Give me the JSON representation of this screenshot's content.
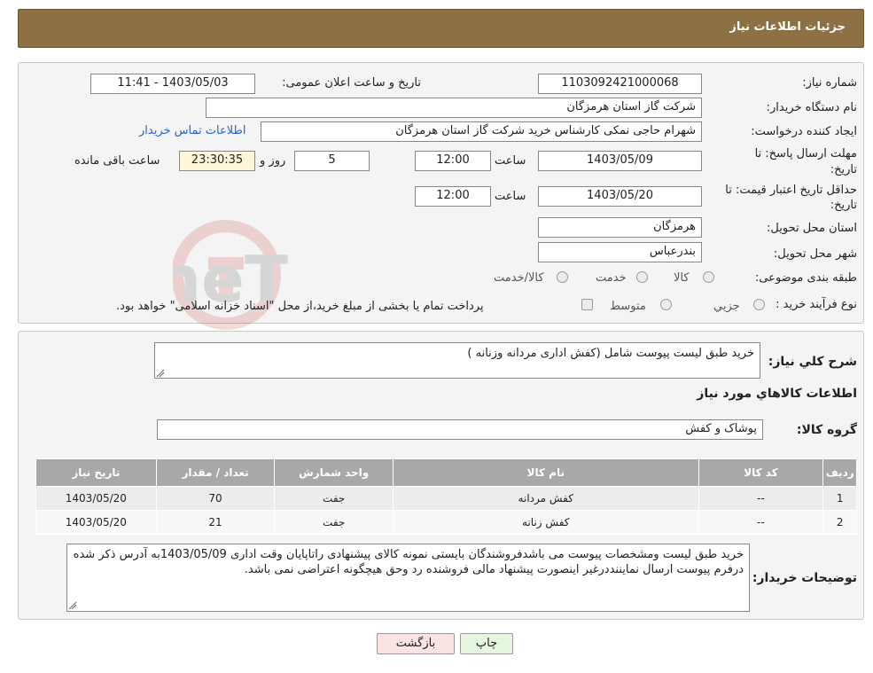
{
  "header": {
    "title": "جزئیات اطلاعات نیاز"
  },
  "details": {
    "need_number_label": "شماره نیاز:",
    "need_number": "1103092421000068",
    "announce_label": "تاریخ و ساعت اعلان عمومی:",
    "announce_value": "1403/05/03 - 11:41",
    "buyer_org_label": "نام دستگاه خریدار:",
    "buyer_org": "شرکت گاز استان هرمزگان",
    "creator_label": "ایجاد کننده درخواست:",
    "creator": "شهرام حاجی نمکی کارشناس خرید شرکت گاز استان هرمزگان",
    "contact_link": "اطلاعات تماس خریدار",
    "deadline_label_1": "مهلت ارسال پاسخ: تا",
    "deadline_label_2": "تاریخ:",
    "deadline_date": "1403/05/09",
    "time_label": "ساعت",
    "deadline_time": "12:00",
    "days_value": "5",
    "days_label": "روز و",
    "remaining_time": "23:30:35",
    "remaining_label": "ساعت باقی مانده",
    "validity_label_1": "حداقل تاریخ اعتبار قیمت: تا",
    "validity_label_2": "تاریخ:",
    "validity_date": "1403/05/20",
    "validity_time": "12:00",
    "province_label": "استان محل تحویل:",
    "province": "هرمزگان",
    "city_label": "شهر محل تحویل:",
    "city": "بندرعباس",
    "category_label": "طبقه بندی موضوعی:",
    "category_options": [
      "کالا",
      "خدمت",
      "کالا/خدمت"
    ],
    "process_label": "نوع فرآیند خرید :",
    "process_options": [
      "جزیي",
      "متوسط"
    ],
    "process_note": "پرداخت تمام یا بخشی از مبلغ خرید،از محل \"اسناد خزانه اسلامی\" خواهد بود."
  },
  "summary": {
    "desc_label": "شرح کلي نیاز:",
    "desc": "خرید طبق لیست پیوست شامل (کفش اداری مردانه وزنانه )",
    "goods_info_title": "اطلاعات کالاهاي مورد نیاز",
    "goods_group_label": "گروه کالا:",
    "goods_group": "پوشاک و کفش"
  },
  "table": {
    "headers": [
      "ردیف",
      "کد کالا",
      "نام کالا",
      "واحد شمارش",
      "تعداد / مقدار",
      "تاریخ نیاز"
    ],
    "rows": [
      [
        "1",
        "--",
        "کفش مردانه",
        "جفت",
        "70",
        "1403/05/20"
      ],
      [
        "2",
        "--",
        "کفش زنانه",
        "جفت",
        "21",
        "1403/05/20"
      ]
    ]
  },
  "buyer_notes": {
    "label": "توضیحات خریدار:",
    "text": "خرید طبق لیست ومشخصات پیوست می باشدفروشندگان بایستی نمونه کالای پیشنهادی راتاپایان  وقت اداری 1403/05/09به آدرس ذکر شده درفرم پیوست ارسال نمایننددرغیر اینصورت پیشنهاد مالی فروشنده رد وحق هیچگونه اعتراضی نمی باشد."
  },
  "buttons": {
    "print": "چاپ",
    "back": "بازگشت"
  },
  "watermark": "AriaTender.neT",
  "colors": {
    "header_bg": "#8d7044",
    "link": "#2a62c9",
    "table_header": "#a8a8a8",
    "back_button": "#fbe3e3",
    "print_button": "#e6f5e0"
  }
}
